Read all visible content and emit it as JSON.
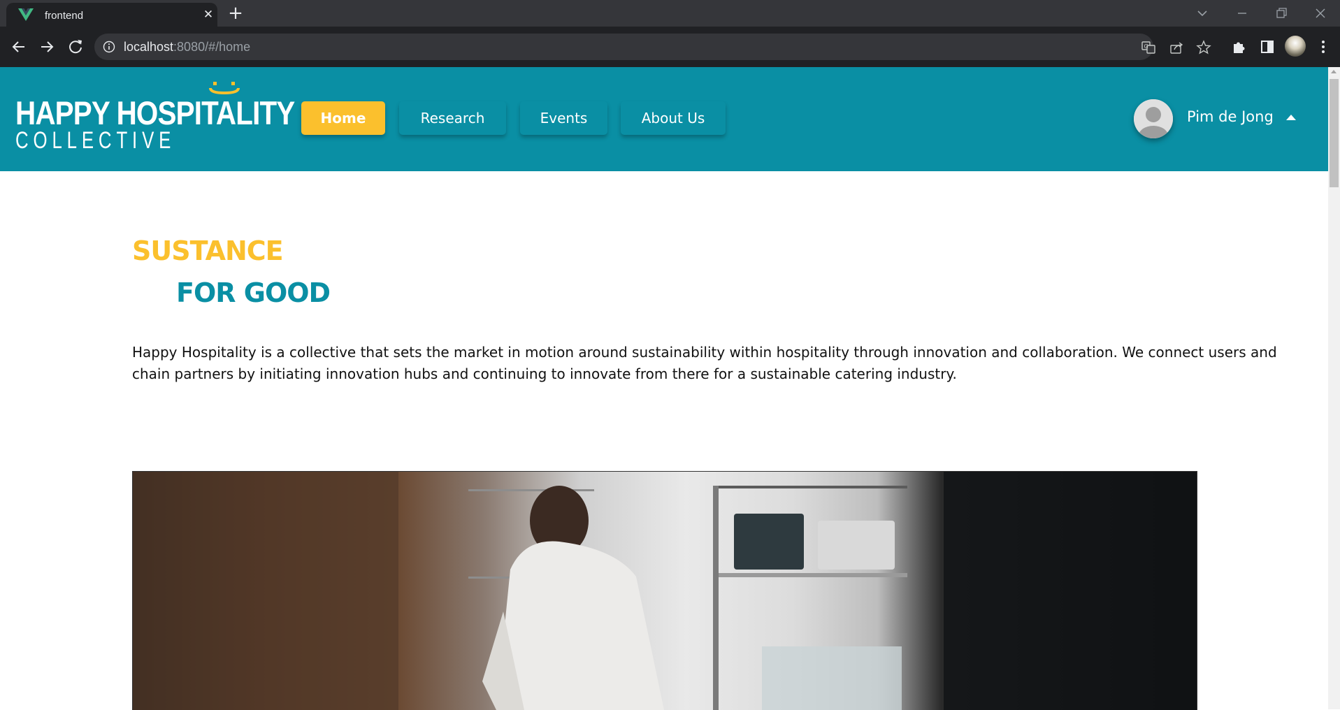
{
  "browser": {
    "tab_title": "frontend",
    "url_host": "localhost",
    "url_path": ":8080/#/home"
  },
  "site": {
    "logo": {
      "line1": "HAPPY HOSPITALITY",
      "line2": "COLLECTIVE"
    },
    "nav": [
      {
        "label": "Home",
        "active": true
      },
      {
        "label": "Research",
        "active": false
      },
      {
        "label": "Events",
        "active": false
      },
      {
        "label": "About Us",
        "active": false
      }
    ],
    "user": {
      "name": "Pim de Jong"
    },
    "colors": {
      "primary": "#0a8fa4",
      "accent": "#fbc02d"
    }
  },
  "content": {
    "headline_line1": "SUSTANCE",
    "headline_line2": "FOR GOOD",
    "intro": "Happy Hospitality is a collective that sets the market in motion around sustainability within hospitality through innovation and collaboration. We connect users and chain partners by initiating innovation hubs and continuing to innovate from there for a sustainable catering industry."
  }
}
